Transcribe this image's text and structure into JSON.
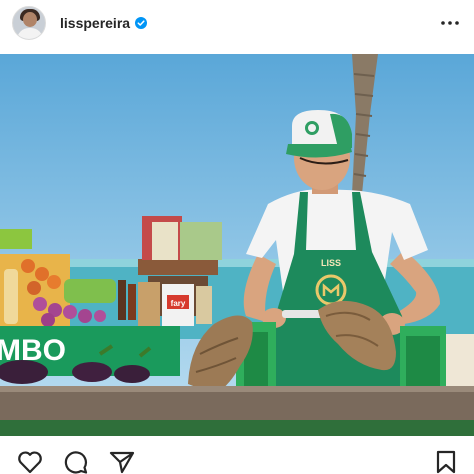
{
  "post": {
    "username": "lisspereira",
    "verified": true
  },
  "photo": {
    "apron_text": "LISS",
    "banner_text": "MBO",
    "package_label": "fary"
  },
  "icons": {
    "verified": "verified-badge-icon",
    "more": "more-options-icon",
    "like": "heart-icon",
    "comment": "comment-icon",
    "share": "send-icon",
    "save": "bookmark-icon"
  },
  "colors": {
    "verified_blue": "#0095f6",
    "apron_green": "#1d8a5c"
  }
}
